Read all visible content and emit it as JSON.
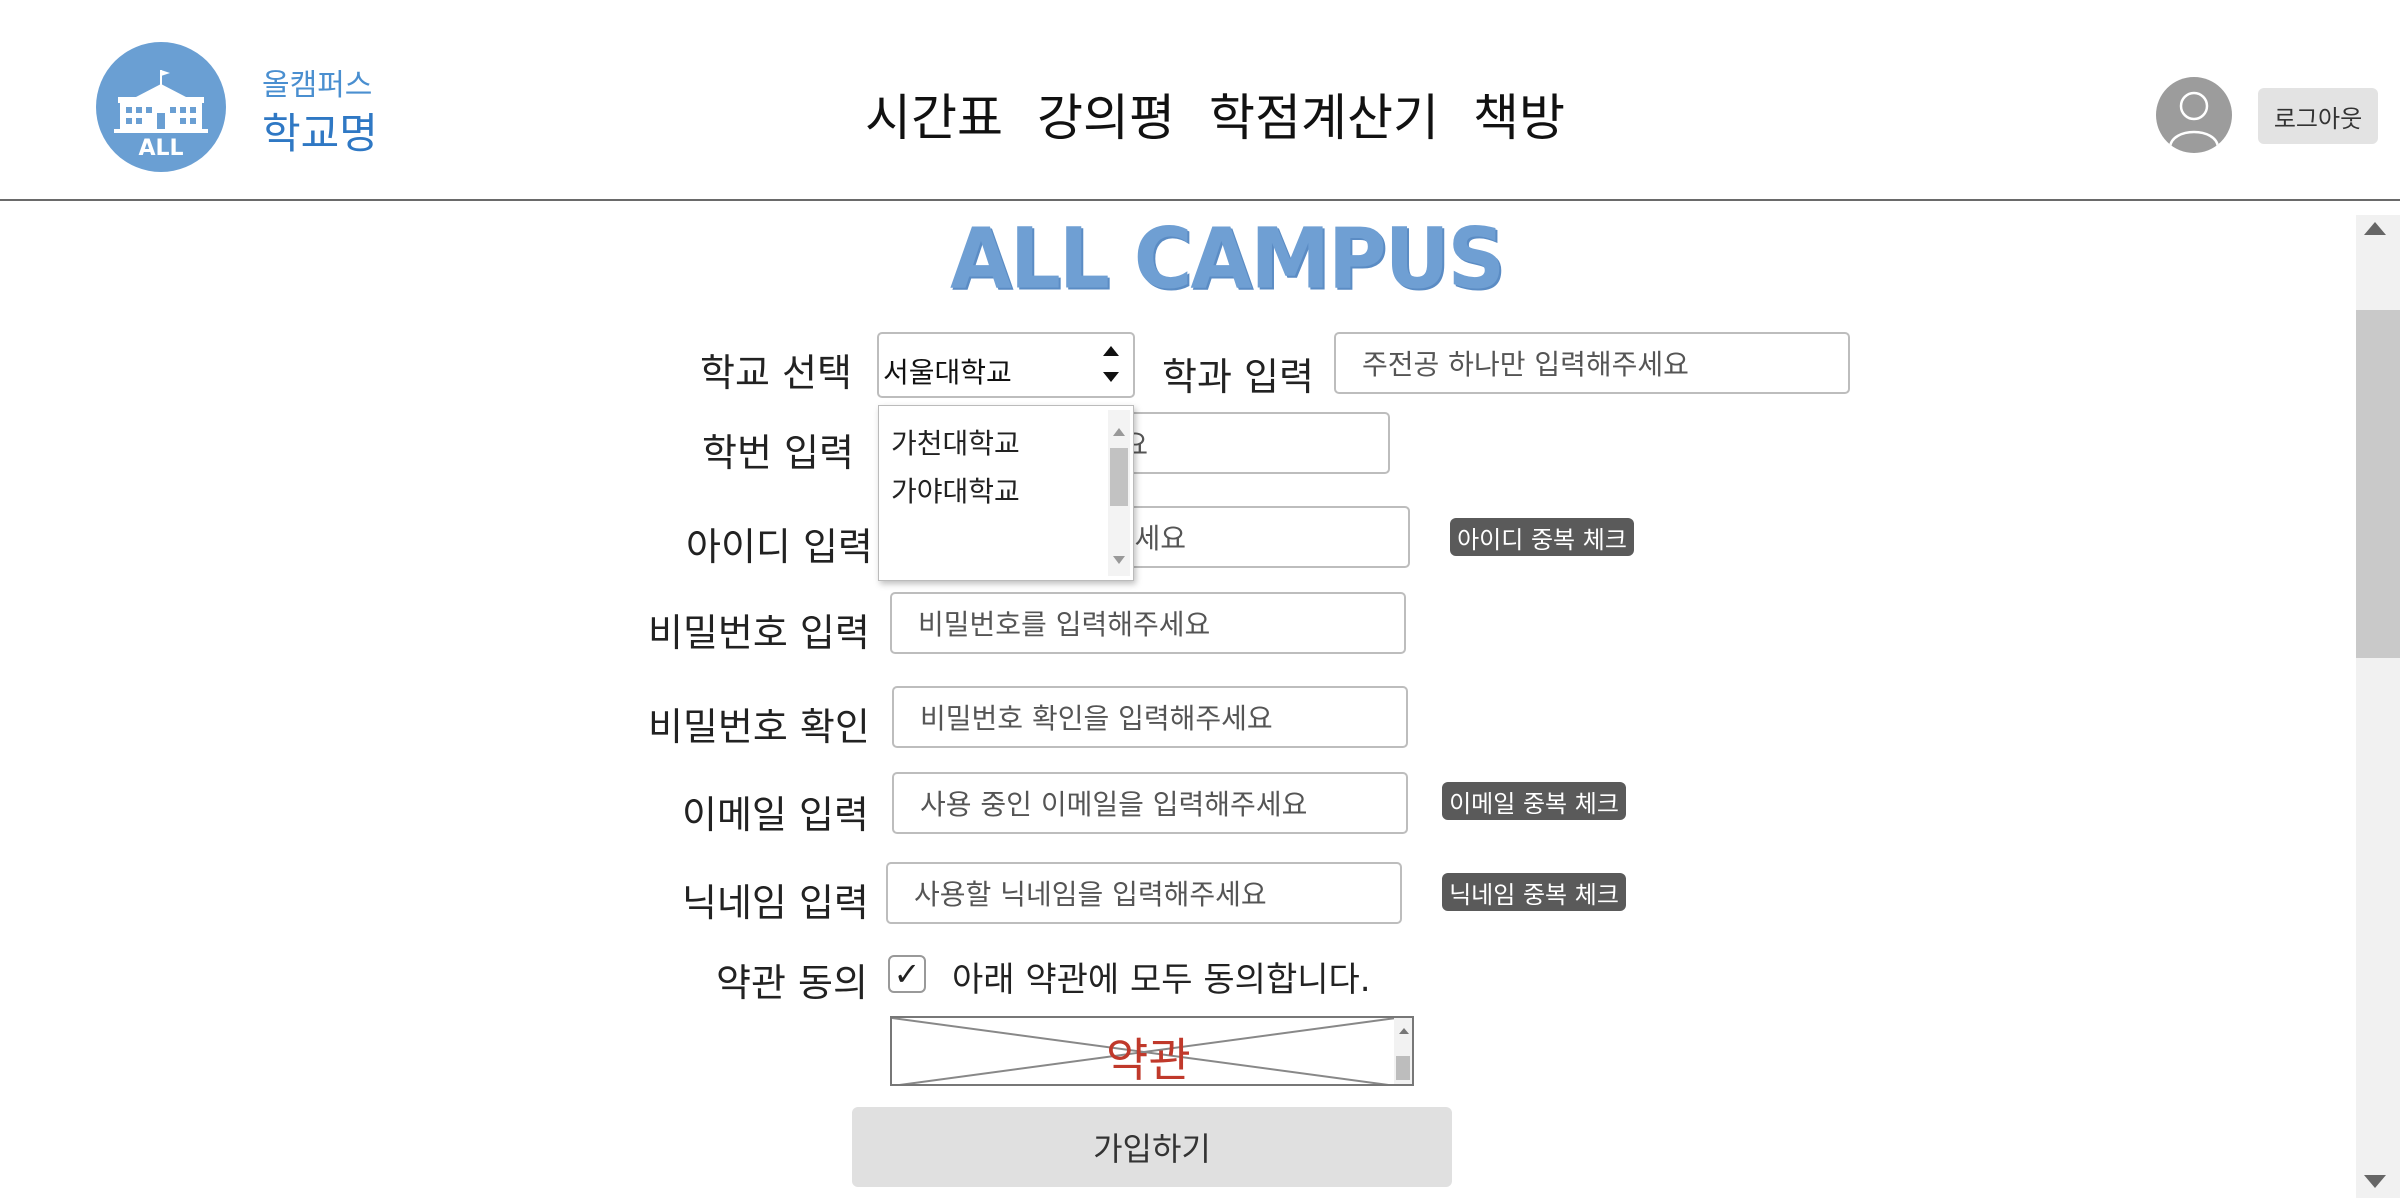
{
  "header": {
    "logo_text": "ALL",
    "brand_sub": "올캠퍼스",
    "brand_name": "학교명",
    "nav": [
      "시간표",
      "강의평",
      "학점계산기",
      "책방"
    ],
    "logout_label": "로그아웃"
  },
  "title": "ALL CAMPUS",
  "form": {
    "school": {
      "label": "학교 선택",
      "selected": "서울대학교",
      "options_visible": [
        "가천대학교",
        "가야대학교"
      ]
    },
    "major": {
      "label": "학과 입력",
      "placeholder": "주전공 하나만 입력해주세요"
    },
    "student_id": {
      "label": "학번 입력",
      "placeholder_visible_part": "요"
    },
    "user_id": {
      "label": "아이디 입력",
      "placeholder_visible_part": "세요",
      "check_label": "아이디 중복 체크"
    },
    "password": {
      "label": "비밀번호 입력",
      "placeholder": "비밀번호를 입력해주세요"
    },
    "password_confirm": {
      "label": "비밀번호 확인",
      "placeholder": "비밀번호 확인을 입력해주세요"
    },
    "email": {
      "label": "이메일 입력",
      "placeholder": "사용 중인 이메일을 입력해주세요",
      "check_label": "이메일 중복 체크"
    },
    "nickname": {
      "label": "닉네임 입력",
      "placeholder": "사용할 닉네임을 입력해주세요",
      "check_label": "닉네임 중복 체크"
    },
    "terms": {
      "label": "약관 동의",
      "checkbox_mark": "✓",
      "checked": true,
      "agree_text": "아래 약관에 모두 동의합니다.",
      "terms_title": "약관"
    },
    "submit_label": "가입하기"
  },
  "colors": {
    "brand_blue": "#6a9fd3",
    "dup_button": "#5a5a5a",
    "terms_text": "#c0392b"
  }
}
